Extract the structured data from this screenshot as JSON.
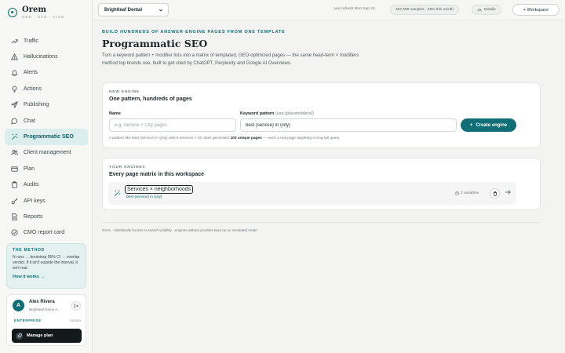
{
  "brand": {
    "name": "Orem",
    "tagline": "GEO · SAO · AIVO"
  },
  "sidebar": {
    "items": [
      {
        "label": "Traffic",
        "icon": "trending-up-icon",
        "active": false
      },
      {
        "label": "Hallucinations",
        "icon": "warning-triangle-icon",
        "active": false
      },
      {
        "label": "Alerts",
        "icon": "bell-icon",
        "active": false
      },
      {
        "label": "Actions",
        "icon": "lightbulb-icon",
        "active": false
      },
      {
        "label": "Publishing",
        "icon": "send-icon",
        "active": false
      },
      {
        "label": "Chat",
        "icon": "chat-bubble-icon",
        "active": false
      },
      {
        "label": "Programmatic SEO",
        "icon": "magic-wand-icon",
        "active": true
      },
      {
        "label": "Client management",
        "icon": "users-icon",
        "active": false
      },
      {
        "label": "Plan",
        "icon": "credit-card-icon",
        "active": false
      },
      {
        "label": "Audits",
        "icon": "clipboard-icon",
        "active": false
      },
      {
        "label": "API keys",
        "icon": "key-icon",
        "active": false
      },
      {
        "label": "Reports",
        "icon": "document-icon",
        "active": false
      },
      {
        "label": "CMO report card",
        "icon": "shield-check-icon",
        "active": false
      }
    ],
    "method": {
      "title": "THE METHOD",
      "body": "N runs → bootstrap 95% CI → overlap verdict. If it isn't outside the interval, it isn't real.",
      "link": "How it works →"
    },
    "user": {
      "initial": "A",
      "name": "Alex Rivera",
      "workspace": "Brightleaf Demo A...",
      "plan_badge": "ENTERPRISE",
      "plan_type": "custom",
      "manage_label": "Manage plan"
    }
  },
  "topbar": {
    "workspace_select": "Brightleaf Dental",
    "refresh_text": "next refresh Mon Sep 23",
    "usage_text": "287,509 samples · 58% this month",
    "details_label": "Details",
    "workspace_button": "+ Workspace"
  },
  "main": {
    "eyebrow": "BUILD HUNDREDS OF ANSWER-ENGINE PAGES FROM ONE TEMPLATE",
    "title": "Programmatic SEO",
    "description": "Turn a keyword pattern + modifier lists into a matrix of templated, GEO-optimized pages — the same head-term × modifiers method top brands use, built to get cited by ChatGPT, Perplexity and Google AI Overviews.",
    "new_engine": {
      "eyebrow": "NEW ENGINE",
      "title": "One pattern, hundreds of pages",
      "name_label": "Name",
      "name_placeholder": "e.g. Service × City pages",
      "pattern_label": "Keyword pattern",
      "pattern_label_hint": "(use {placeholders})",
      "pattern_value": "best {service} in {city}",
      "create_label": "Create engine",
      "hint_prefix": "A pattern like best {service} in {city} with 5 services × 20 cities generates ",
      "hint_bold": "100 unique pages",
      "hint_suffix": " — each a real page targeting a long-tail query."
    },
    "your_engines": {
      "eyebrow": "YOUR ENGINES",
      "title": "Every page matrix in this workspace",
      "engines": [
        {
          "name": "Services × neighborhoods",
          "pattern": "best {service} in {city}",
          "variables": "2 variables"
        }
      ]
    },
    "footer_note": "Orem · statistically honest AI-search visibility · engines without provider keys run in simulated mode"
  }
}
